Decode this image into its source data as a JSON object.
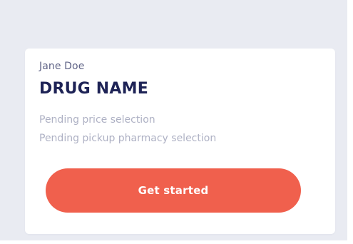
{
  "card": {
    "patient_name": "Jane Doe",
    "drug_name": "DRUG NAME",
    "status_lines": [
      "Pending price selection",
      "Pending pickup pharmacy selection"
    ],
    "cta_label": "Get started"
  },
  "colors": {
    "page_background": "#e9ebf2",
    "card_background": "#ffffff",
    "primary_text": "#1e2356",
    "secondary_text": "#5f6386",
    "muted_text": "#aeb1c4",
    "accent": "#f0604d"
  }
}
